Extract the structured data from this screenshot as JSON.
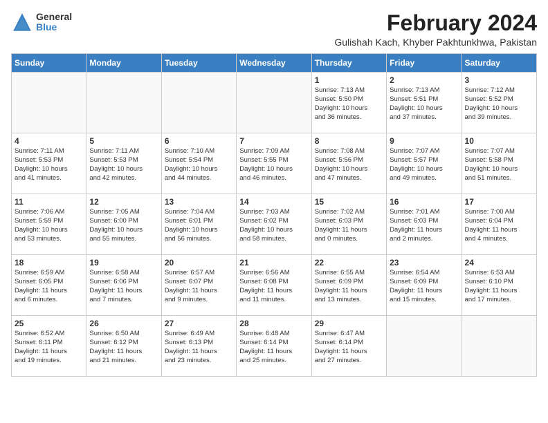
{
  "logo": {
    "general": "General",
    "blue": "Blue"
  },
  "title": "February 2024",
  "subtitle": "Gulishah Kach, Khyber Pakhtunkhwa, Pakistan",
  "days_of_week": [
    "Sunday",
    "Monday",
    "Tuesday",
    "Wednesday",
    "Thursday",
    "Friday",
    "Saturday"
  ],
  "weeks": [
    [
      {
        "day": "",
        "info": ""
      },
      {
        "day": "",
        "info": ""
      },
      {
        "day": "",
        "info": ""
      },
      {
        "day": "",
        "info": ""
      },
      {
        "day": "1",
        "info": "Sunrise: 7:13 AM\nSunset: 5:50 PM\nDaylight: 10 hours\nand 36 minutes."
      },
      {
        "day": "2",
        "info": "Sunrise: 7:13 AM\nSunset: 5:51 PM\nDaylight: 10 hours\nand 37 minutes."
      },
      {
        "day": "3",
        "info": "Sunrise: 7:12 AM\nSunset: 5:52 PM\nDaylight: 10 hours\nand 39 minutes."
      }
    ],
    [
      {
        "day": "4",
        "info": "Sunrise: 7:11 AM\nSunset: 5:53 PM\nDaylight: 10 hours\nand 41 minutes."
      },
      {
        "day": "5",
        "info": "Sunrise: 7:11 AM\nSunset: 5:53 PM\nDaylight: 10 hours\nand 42 minutes."
      },
      {
        "day": "6",
        "info": "Sunrise: 7:10 AM\nSunset: 5:54 PM\nDaylight: 10 hours\nand 44 minutes."
      },
      {
        "day": "7",
        "info": "Sunrise: 7:09 AM\nSunset: 5:55 PM\nDaylight: 10 hours\nand 46 minutes."
      },
      {
        "day": "8",
        "info": "Sunrise: 7:08 AM\nSunset: 5:56 PM\nDaylight: 10 hours\nand 47 minutes."
      },
      {
        "day": "9",
        "info": "Sunrise: 7:07 AM\nSunset: 5:57 PM\nDaylight: 10 hours\nand 49 minutes."
      },
      {
        "day": "10",
        "info": "Sunrise: 7:07 AM\nSunset: 5:58 PM\nDaylight: 10 hours\nand 51 minutes."
      }
    ],
    [
      {
        "day": "11",
        "info": "Sunrise: 7:06 AM\nSunset: 5:59 PM\nDaylight: 10 hours\nand 53 minutes."
      },
      {
        "day": "12",
        "info": "Sunrise: 7:05 AM\nSunset: 6:00 PM\nDaylight: 10 hours\nand 55 minutes."
      },
      {
        "day": "13",
        "info": "Sunrise: 7:04 AM\nSunset: 6:01 PM\nDaylight: 10 hours\nand 56 minutes."
      },
      {
        "day": "14",
        "info": "Sunrise: 7:03 AM\nSunset: 6:02 PM\nDaylight: 10 hours\nand 58 minutes."
      },
      {
        "day": "15",
        "info": "Sunrise: 7:02 AM\nSunset: 6:03 PM\nDaylight: 11 hours\nand 0 minutes."
      },
      {
        "day": "16",
        "info": "Sunrise: 7:01 AM\nSunset: 6:03 PM\nDaylight: 11 hours\nand 2 minutes."
      },
      {
        "day": "17",
        "info": "Sunrise: 7:00 AM\nSunset: 6:04 PM\nDaylight: 11 hours\nand 4 minutes."
      }
    ],
    [
      {
        "day": "18",
        "info": "Sunrise: 6:59 AM\nSunset: 6:05 PM\nDaylight: 11 hours\nand 6 minutes."
      },
      {
        "day": "19",
        "info": "Sunrise: 6:58 AM\nSunset: 6:06 PM\nDaylight: 11 hours\nand 7 minutes."
      },
      {
        "day": "20",
        "info": "Sunrise: 6:57 AM\nSunset: 6:07 PM\nDaylight: 11 hours\nand 9 minutes."
      },
      {
        "day": "21",
        "info": "Sunrise: 6:56 AM\nSunset: 6:08 PM\nDaylight: 11 hours\nand 11 minutes."
      },
      {
        "day": "22",
        "info": "Sunrise: 6:55 AM\nSunset: 6:09 PM\nDaylight: 11 hours\nand 13 minutes."
      },
      {
        "day": "23",
        "info": "Sunrise: 6:54 AM\nSunset: 6:09 PM\nDaylight: 11 hours\nand 15 minutes."
      },
      {
        "day": "24",
        "info": "Sunrise: 6:53 AM\nSunset: 6:10 PM\nDaylight: 11 hours\nand 17 minutes."
      }
    ],
    [
      {
        "day": "25",
        "info": "Sunrise: 6:52 AM\nSunset: 6:11 PM\nDaylight: 11 hours\nand 19 minutes."
      },
      {
        "day": "26",
        "info": "Sunrise: 6:50 AM\nSunset: 6:12 PM\nDaylight: 11 hours\nand 21 minutes."
      },
      {
        "day": "27",
        "info": "Sunrise: 6:49 AM\nSunset: 6:13 PM\nDaylight: 11 hours\nand 23 minutes."
      },
      {
        "day": "28",
        "info": "Sunrise: 6:48 AM\nSunset: 6:14 PM\nDaylight: 11 hours\nand 25 minutes."
      },
      {
        "day": "29",
        "info": "Sunrise: 6:47 AM\nSunset: 6:14 PM\nDaylight: 11 hours\nand 27 minutes."
      },
      {
        "day": "",
        "info": ""
      },
      {
        "day": "",
        "info": ""
      }
    ]
  ]
}
